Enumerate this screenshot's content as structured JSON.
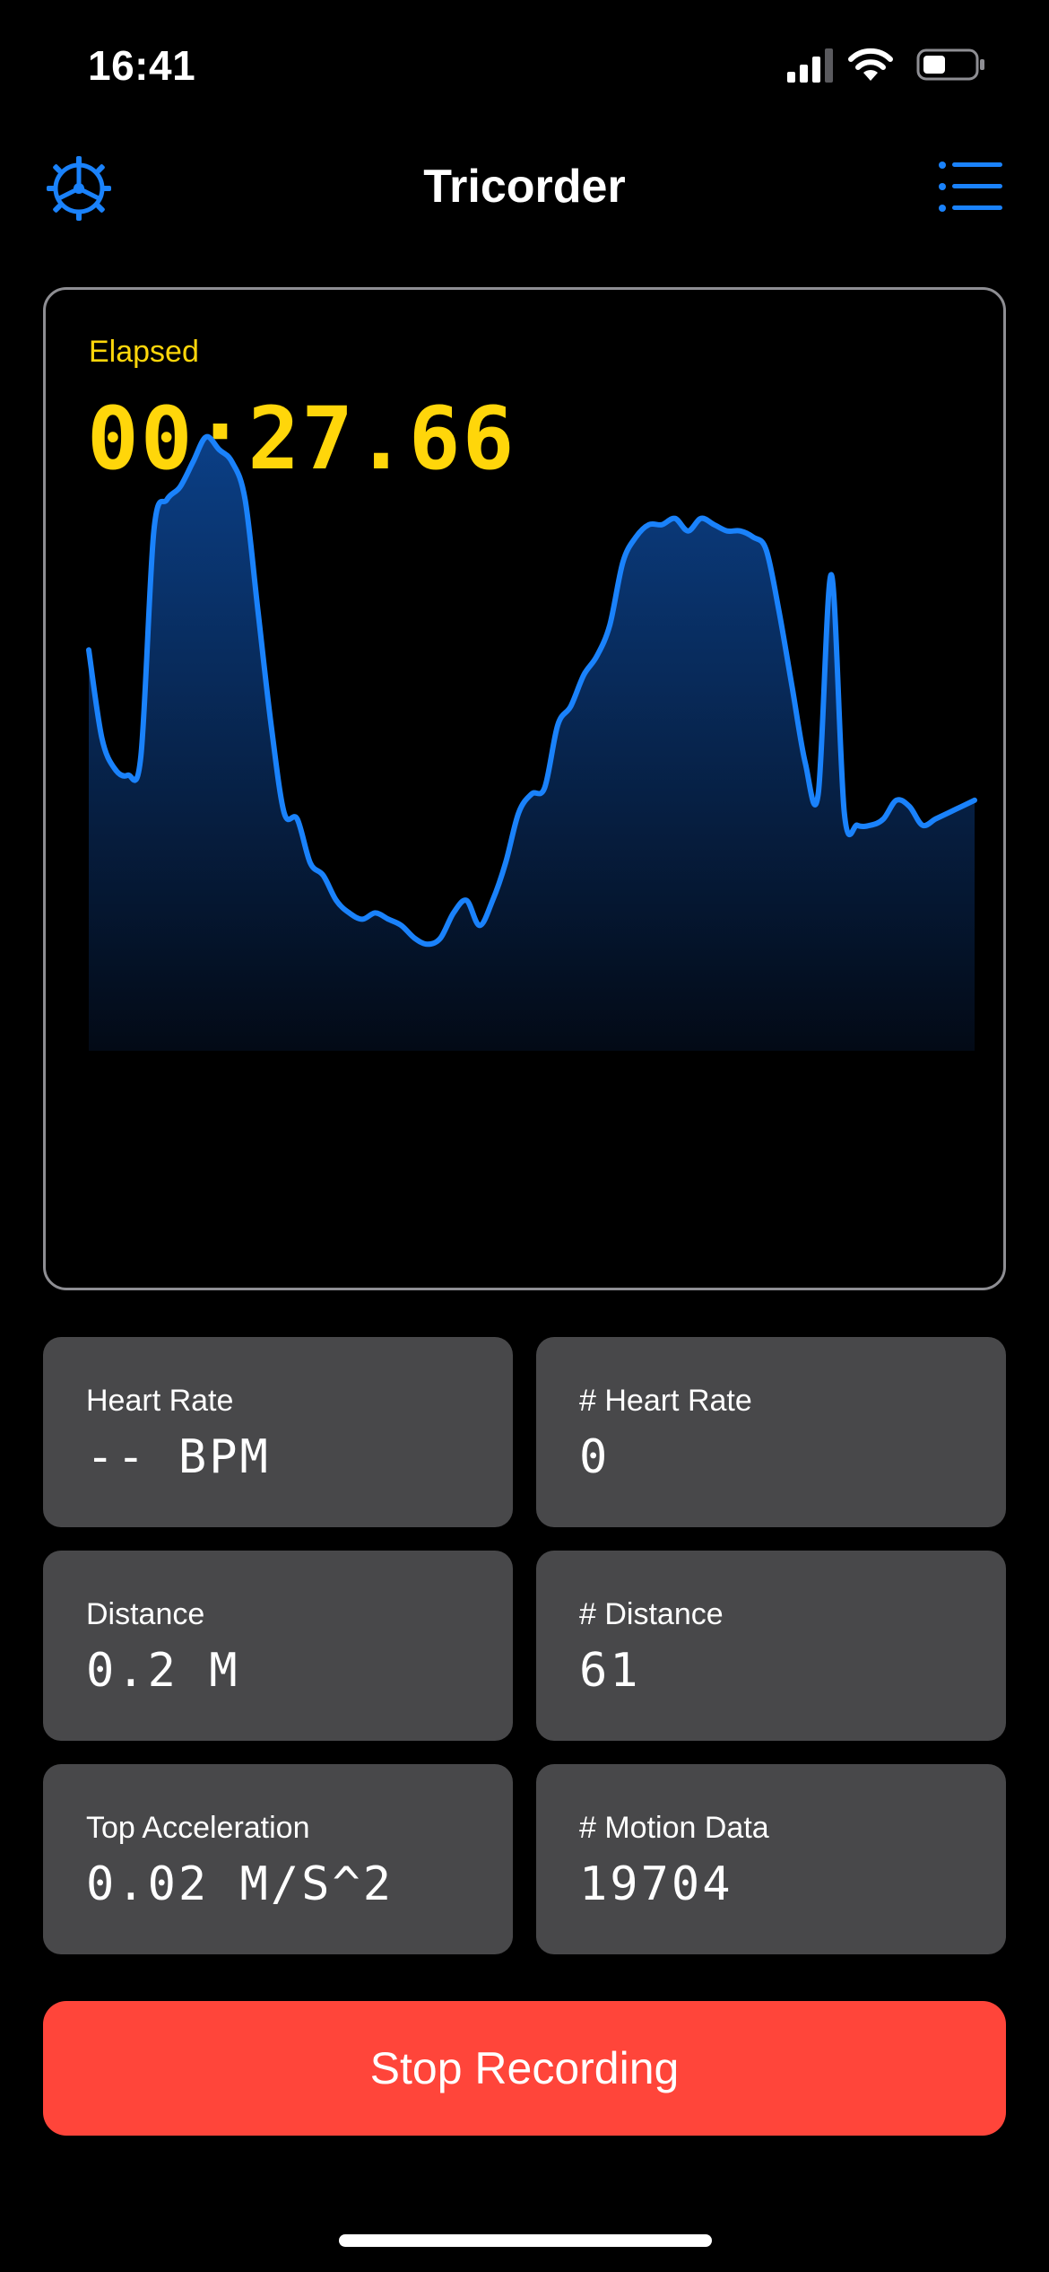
{
  "status_bar": {
    "time": "16:41"
  },
  "nav": {
    "title": "Tricorder",
    "left_icon": "settings-wheel-icon",
    "right_icon": "list-icon"
  },
  "colors": {
    "accent": "#1a82fb",
    "elapsed": "#ffd60a",
    "tile_bg": "#48484a",
    "stop_button": "#ff453a",
    "card_border": "#8e8e93"
  },
  "elapsed": {
    "label": "Elapsed",
    "value": "00:27.66"
  },
  "chart_data": {
    "type": "area",
    "x": [
      0,
      1,
      2,
      3,
      4,
      5,
      6,
      7,
      8,
      9,
      10,
      11,
      12,
      13,
      14,
      15,
      16,
      17,
      18,
      19,
      20,
      21,
      22,
      23,
      24,
      25,
      26,
      27,
      28,
      29,
      30,
      31,
      32,
      33,
      34,
      35,
      36,
      37,
      38,
      39,
      40,
      41,
      42,
      43,
      44,
      45,
      46,
      47,
      48,
      49,
      50,
      51,
      52,
      53,
      54,
      55,
      56,
      57,
      58,
      59,
      60,
      61,
      62,
      63,
      64,
      65,
      66,
      67,
      68,
      69,
      70,
      71,
      72,
      73,
      74,
      75,
      76,
      77,
      78,
      79,
      80,
      81,
      82,
      83,
      84,
      85,
      86,
      87,
      88,
      89,
      90,
      91,
      92,
      93,
      94,
      95,
      96,
      97,
      98,
      99,
      100,
      101,
      102,
      103,
      104,
      105,
      106,
      107,
      108,
      109,
      110,
      111,
      112,
      113,
      114,
      115,
      116,
      117,
      118,
      119,
      120
    ],
    "values": [
      64,
      50,
      45,
      44,
      47,
      83,
      88,
      90,
      94,
      98,
      96,
      94,
      88,
      70,
      52,
      38,
      37,
      30,
      28,
      24,
      22,
      21,
      22,
      21,
      20,
      18,
      17,
      18,
      22,
      24,
      20,
      24,
      30,
      38,
      41,
      42,
      52,
      55,
      60,
      63,
      68,
      78,
      82,
      84,
      84,
      85,
      83,
      85,
      84,
      83,
      83,
      82,
      80,
      70,
      58,
      46,
      41,
      76,
      38,
      36,
      36,
      37,
      40,
      39,
      36,
      37,
      38,
      39,
      40
    ],
    "xlim": [
      0,
      120
    ],
    "ylim": [
      0,
      100
    ],
    "grid": false
  },
  "metrics": [
    {
      "label": "Heart Rate",
      "value": "-- BPM"
    },
    {
      "label": "# Heart Rate",
      "value": "0"
    },
    {
      "label": "Distance",
      "value": "0.2 M"
    },
    {
      "label": "# Distance",
      "value": "61"
    },
    {
      "label": "Top Acceleration",
      "value": "0.02 M/S^2"
    },
    {
      "label": "# Motion Data",
      "value": "19704"
    }
  ],
  "stop_button": {
    "label": "Stop Recording"
  }
}
